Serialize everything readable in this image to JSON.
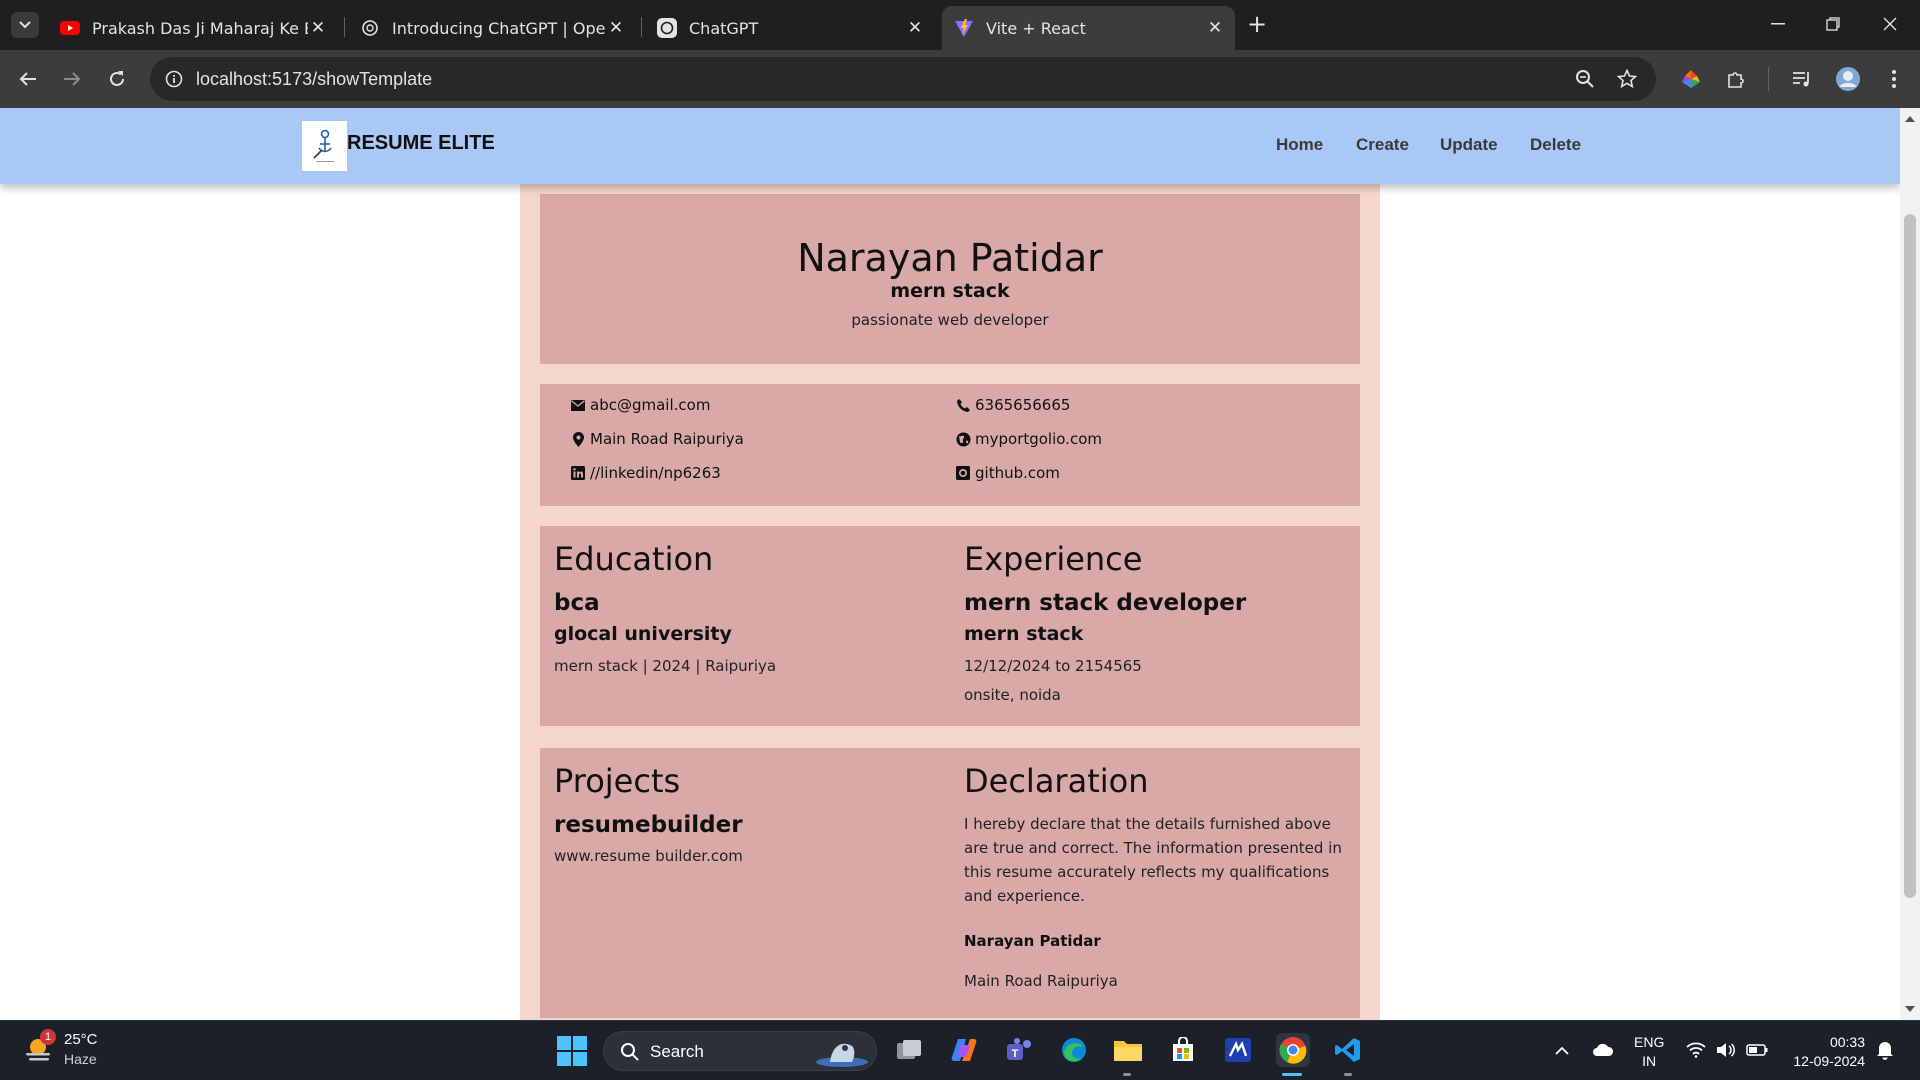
{
  "browser": {
    "tabs": [
      {
        "title": "Prakash Das Ji Maharaj Ke Bhaja",
        "favicon": "youtube-icon"
      },
      {
        "title": "Introducing ChatGPT | OpenAI",
        "favicon": "openai-icon"
      },
      {
        "title": "ChatGPT",
        "favicon": "chatgpt-icon"
      },
      {
        "title": "Vite + React",
        "favicon": "vite-icon"
      }
    ],
    "active_tab": 3,
    "url": "localhost:5173/showTemplate"
  },
  "navbar": {
    "brand": "RESUME ELITE",
    "links": [
      "Home",
      "Create",
      "Update",
      "Delete"
    ],
    "background": "#a9c8f5"
  },
  "resume": {
    "name": "Narayan Patidar",
    "role": "mern stack",
    "summary": "passionate web developer",
    "contact": {
      "email": "abc@gmail.com",
      "phone": "6365656665",
      "address": "Main Road Raipuriya",
      "portfolio": "myportgolio.com",
      "linkedin": "//linkedin/np6263",
      "github": "github.com"
    },
    "education": {
      "heading": "Education",
      "degree": "bca",
      "institution": "glocal university",
      "details": "mern stack | 2024 | Raipuriya"
    },
    "experience": {
      "heading": "Experience",
      "title": "mern stack developer",
      "company": "mern stack",
      "dates": "12/12/2024 to 2154565",
      "location": "onsite, noida"
    },
    "projects": {
      "heading": "Projects",
      "title": "resumebuilder",
      "link": "www.resume builder.com"
    },
    "declaration": {
      "heading": "Declaration",
      "text": "I hereby declare that the details furnished above are true and correct. The information presented in this resume accurately reflects my qualifications and experience.",
      "name": "Narayan Patidar",
      "place": "Main Road Raipuriya"
    },
    "colors": {
      "outer": "#f5d6cc",
      "card": "#d9a9a8"
    }
  },
  "taskbar": {
    "weather": {
      "temp": "25°C",
      "condition": "Haze",
      "badge": "1"
    },
    "search_label": "Search",
    "language": {
      "line1": "ENG",
      "line2": "IN"
    },
    "time": "00:33",
    "date": "12-09-2024"
  }
}
